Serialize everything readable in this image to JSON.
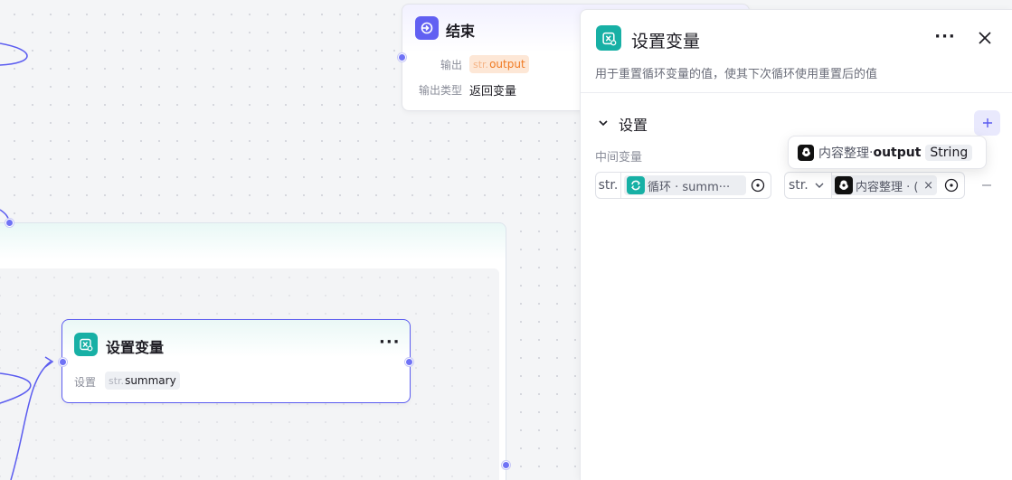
{
  "canvas": {
    "end_node": {
      "title": "结束",
      "output_label": "输出",
      "output_prefix": "str.",
      "output_value": "output",
      "output_type_label": "输出类型",
      "output_type_value": "返回变量"
    },
    "setvar_node": {
      "title": "设置变量",
      "setting_label": "设置",
      "var_prefix": "str.",
      "var_value": "summary"
    }
  },
  "panel": {
    "title": "设置变量",
    "description": "用于重置循环变量的值，使其下次循环使用重置后的值",
    "section_title": "设置",
    "intermediate_label": "中间变量",
    "left_var": {
      "prefix": "str.",
      "text": "循环 · summ···"
    },
    "right_var": {
      "prefix": "str.",
      "text": "内容整理 · ("
    },
    "tooltip": {
      "node_name": "内容整理",
      "separator": " · ",
      "var_name": "output",
      "type": "String"
    }
  },
  "colors": {
    "accent": "#5b5cf0",
    "teal_icon": "#17b0a5",
    "end_icon": "#6160f2",
    "output_tag_bg": "#fde7d6",
    "output_tag_fg": "#f07a22"
  },
  "icons": {
    "end_node": "exit-icon",
    "setvar": "variable-icon",
    "loop": "loop-icon",
    "content": "llm-icon"
  }
}
